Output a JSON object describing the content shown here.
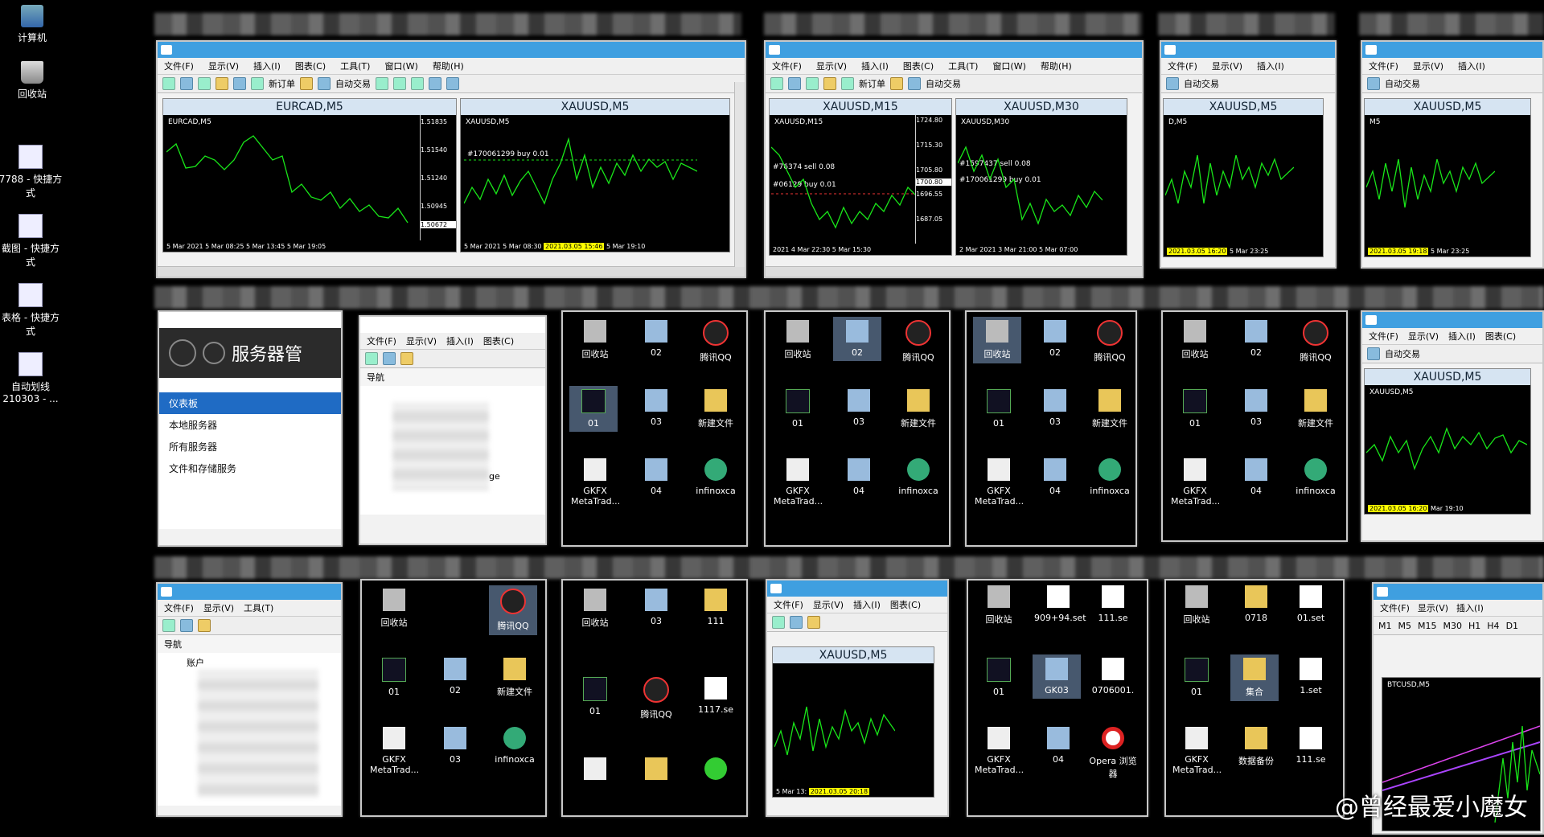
{
  "desktop": {
    "icons": [
      {
        "label": "计算机",
        "icon": "computer-icon"
      },
      {
        "label": "回收站",
        "icon": "recycle-bin-icon"
      },
      {
        "label": "7788 - 快捷方式",
        "icon": "shortcut-icon"
      },
      {
        "label": "截图 - 快捷方式",
        "icon": "shortcut-icon"
      },
      {
        "label": "表格 - 快捷方式",
        "icon": "shortcut-icon"
      },
      {
        "label": "自动划线 210303 - ...",
        "icon": "shortcut-icon"
      }
    ]
  },
  "mt4": {
    "menu_full": [
      "文件(F)",
      "显示(V)",
      "插入(I)",
      "图表(C)",
      "工具(T)",
      "窗口(W)",
      "帮助(H)"
    ],
    "menu_short": [
      "文件(F)",
      "显示(V)",
      "插入(I)",
      "图表(C)"
    ],
    "new_order": "新订单",
    "auto_trade": "自动交易"
  },
  "windows": {
    "w1": {
      "chart_a": {
        "title": "EURCAD,M5",
        "label": "EURCAD,M5",
        "times": "5 Mar 2021   5 Mar 08:25   5 Mar 13:45   5 Mar 19:05",
        "prices": [
          "1.51835",
          "1.51540",
          "1.51240",
          "1.50945",
          "1.50672"
        ]
      },
      "chart_b": {
        "title": "XAUUSD,M5",
        "label": "XAUUSD,M5",
        "order": "#170061299 buy 0.01",
        "times": "5 Mar 2021   5 Mar 08:30",
        "highlight": "2021.03.05 15:46",
        "times2": "5 Mar 19:10"
      }
    },
    "w2": {
      "chart_a": {
        "title": "XAUUSD,M15",
        "label": "XAUUSD,M15",
        "sell": "#76374 sell 0.08",
        "buy": "#06129 buy 0.01",
        "times": "2021   4 Mar 22:30   5 Mar 15:30",
        "prices": [
          "1724.80",
          "1715.30",
          "1705.80",
          "1700.80",
          "1696.55",
          "1687.05"
        ]
      },
      "chart_b": {
        "title": "XAUUSD,M30",
        "label": "XAUUSD,M30",
        "sell": "#1597437 sell 0.08",
        "buy": "#170061299 buy 0.01",
        "times": "2 Mar 2021   3 Mar 21:00   5 Mar 07:00"
      }
    },
    "w3": {
      "title": "XAUUSD,M5",
      "label": "D,M5",
      "highlight": "2021.03.05 16:20",
      "times": "5 Mar 23:25"
    },
    "w4": {
      "title": "XAUUSD,M5",
      "label": "M5",
      "highlight": "2021.03.05 19:18",
      "times": "5 Mar 23:25"
    },
    "w5": {
      "title": "XAUUSD,M5",
      "label": "XAUUSD,M5",
      "highlight": "2021.03.05 16:20",
      "times": "Mar 19:10"
    },
    "w6": {
      "title": "XAUUSD,M5",
      "highlight": "2021.03.05 20:18",
      "times": "5 Mar 13:"
    },
    "w7": {
      "label": "BTCUSD,M5",
      "periods": [
        "M1",
        "M5",
        "M15",
        "M30",
        "H1",
        "H4",
        "D1"
      ]
    }
  },
  "server_manager": {
    "title": "服务器管",
    "items": [
      "仪表板",
      "本地服务器",
      "所有服务器",
      "文件和存储服务"
    ]
  },
  "navigator": {
    "title": "导航",
    "partial_text": "ge",
    "account": "账户"
  },
  "desktop_thumbs": {
    "set1": [
      "回收站",
      "02",
      "腾讯QQ",
      "01",
      "03",
      "新建文件",
      "GKFX MetaTrad...",
      "04",
      "infinoxca"
    ],
    "set_b": [
      "回收站",
      "02",
      "腾讯QQ",
      "01",
      "03",
      "新建文件",
      "GKFX MetaTrad...",
      "03",
      "infinoxca"
    ],
    "set_c": [
      "回收站",
      "03",
      "111",
      "01",
      "腾讯QQ",
      "1117.se"
    ],
    "set_d": [
      "回收站",
      "909+94.set",
      "111.se",
      "01",
      "GK03",
      "0706001.",
      "GKFX MetaTrad...",
      "04",
      "Opera 浏览器"
    ],
    "set_e": [
      "回收站",
      "0718",
      "01.set",
      "01",
      "集合",
      "1.set",
      "GKFX MetaTrad...",
      "数据备份",
      "111.se"
    ]
  },
  "watermark": "@曾经最爱小魔女"
}
